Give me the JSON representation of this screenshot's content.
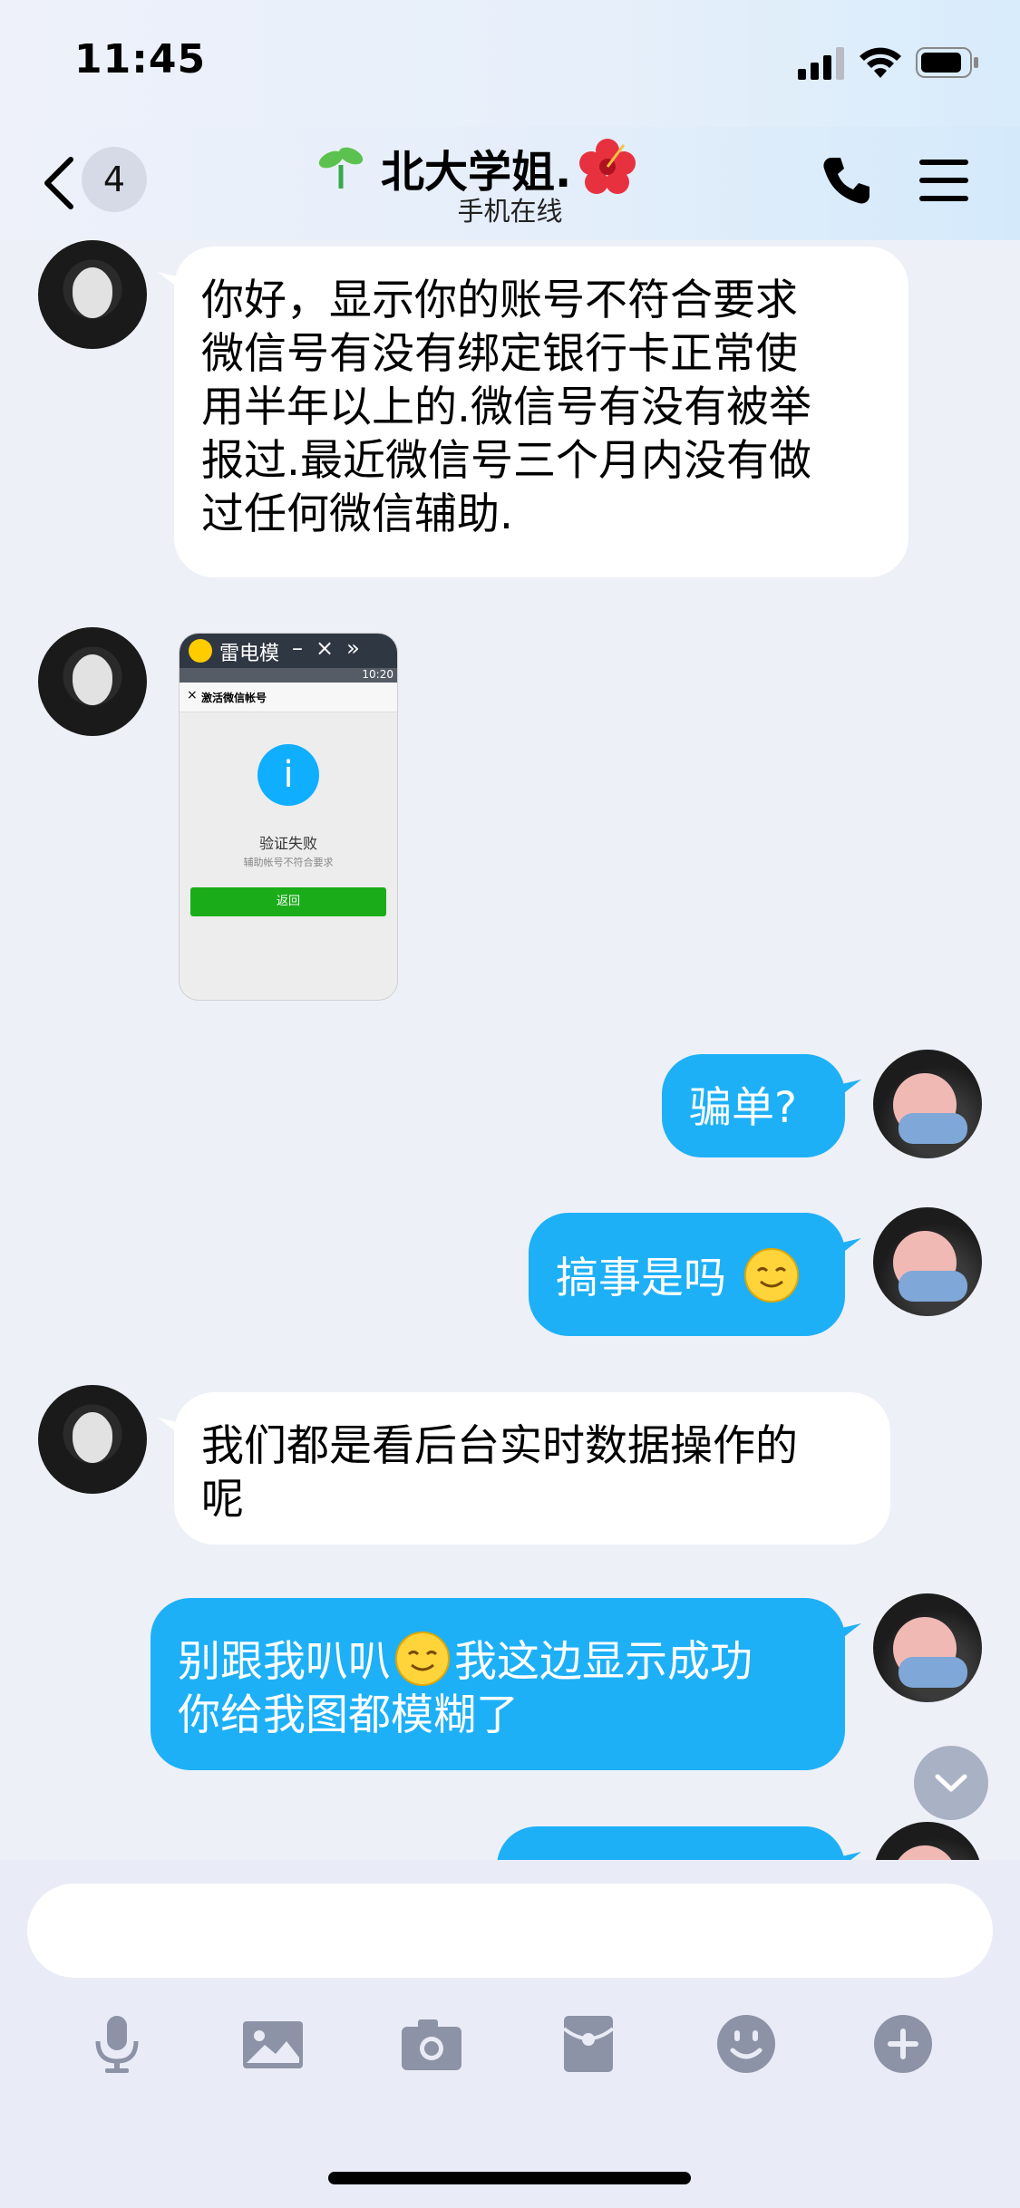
{
  "status_bar": {
    "time": "11:45"
  },
  "nav": {
    "back_badge": "4",
    "title": "北大学姐.",
    "subtitle": "手机在线"
  },
  "messages": [
    {
      "side": "in",
      "type": "text",
      "text": "你好，显示你的账号不符合要求\n微信号有没有绑定银行卡正常使\n用半年以上的.微信号有没有被举\n报过.最近微信号三个月内没有做\n过任何微信辅助."
    },
    {
      "side": "in",
      "type": "image",
      "screenshot": {
        "app_name": "雷电模",
        "status_time": "10:20",
        "header": "激活微信帐号",
        "info_symbol": "i",
        "fail_title": "验证失败",
        "fail_sub": "辅助帐号不符合要求",
        "button": "返回"
      }
    },
    {
      "side": "out",
      "type": "text",
      "text": "骗单?"
    },
    {
      "side": "out",
      "type": "text",
      "text": "搞事是吗",
      "emoji": "smile-emoji"
    },
    {
      "side": "in",
      "type": "text",
      "text": "我们都是看后台实时数据操作的\n呢"
    },
    {
      "side": "out",
      "type": "text",
      "text_a": "别跟我叭叭",
      "emoji": "smile-emoji",
      "text_b": "我这边显示成功\n你给我图都模糊了"
    }
  ],
  "toolbar": {
    "icons": [
      "microphone-icon",
      "image-icon",
      "camera-icon",
      "red-packet-icon",
      "emoji-icon",
      "plus-icon"
    ]
  },
  "colors": {
    "outgoing_bubble": "#1eb0f7",
    "incoming_bubble": "#ffffff",
    "background": "#eef0f8"
  }
}
